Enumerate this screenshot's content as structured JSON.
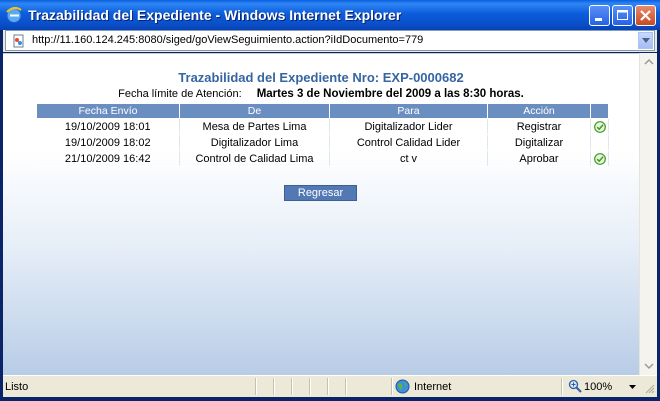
{
  "window": {
    "title": "Trazabilidad del Expediente - Windows Internet Explorer",
    "address": "http://11.160.124.245:8080/siged/goViewSeguimiento.action?iIdDocumento=779"
  },
  "page": {
    "heading": "Trazabilidad del Expediente Nro: EXP-0000682",
    "deadline_label": "Fecha límite de Atención:",
    "deadline_value": "Martes 3 de Noviembre del 2009 a las 8:30 horas.",
    "table": {
      "headers": [
        "Fecha Envío",
        "De",
        "Para",
        "Acción",
        ""
      ],
      "rows": [
        {
          "fecha": "19/10/2009 18:01",
          "de": "Mesa de Partes Lima",
          "para": "Digitalizador Lider",
          "accion": "Registrar",
          "icon": "check-circle-icon"
        },
        {
          "fecha": "19/10/2009 18:02",
          "de": "Digitalizador Lima",
          "para": "Control Calidad Lider",
          "accion": "Digitalizar",
          "icon": ""
        },
        {
          "fecha": "21/10/2009 16:42",
          "de": "Control de Calidad Lima",
          "para": "ct v",
          "accion": "Aprobar",
          "icon": "check-circle-icon"
        }
      ]
    },
    "back_button": "Regresar"
  },
  "statusbar": {
    "status": "Listo",
    "zone": "Internet",
    "zoom": "100%"
  },
  "colors": {
    "header_bg": "#6b8ec1",
    "heading_text": "#3565a3",
    "button_bg": "#5279b4",
    "check_green": "#3c9a1e"
  }
}
